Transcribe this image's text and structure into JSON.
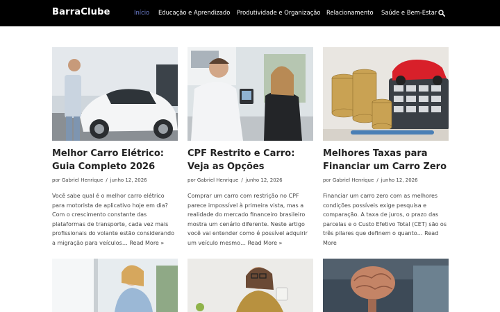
{
  "header": {
    "brand": "BarraClube",
    "nav": [
      {
        "label": "Início",
        "active": true
      },
      {
        "label": "Educação e Aprendizado",
        "active": false
      },
      {
        "label": "Produtividade e Organização",
        "active": false
      },
      {
        "label": "Relacionamento",
        "active": false
      },
      {
        "label": "Saúde e Bem-Estar",
        "active": false
      }
    ],
    "search_icon": "search-icon"
  },
  "colors": {
    "topbar": "#000000",
    "nav_active": "#6d7fd0",
    "title": "#222222",
    "text": "#444444"
  },
  "posts": [
    {
      "title": "Melhor Carro Elétrico: Guia Completo 2026",
      "author": "por Gabriel Henrique",
      "date": "junho 12, 2026",
      "excerpt": "Você sabe qual é o melhor carro elétrico para motorista de aplicativo hoje em dia? Com o crescimento constante das plataformas de transporte, cada vez mais profissionais do volante estão considerando a migração para veículos…",
      "read_more": "Read More »",
      "image": "man charging white electric car"
    },
    {
      "title": "CPF Restrito e Carro: Veja as Opções",
      "author": "por Gabriel Henrique",
      "date": "junho 12, 2026",
      "excerpt": "Comprar um carro com restrição no CPF parece impossível à primeira vista, mas a realidade do mercado financeiro brasileiro mostra um cenário diferente. Neste artigo você vai entender como é possível adquirir um veículo mesmo…",
      "read_more": "Read More »",
      "image": "car dealer with client at desk"
    },
    {
      "title": "Melhores Taxas para Financiar um Carro Zero",
      "author": "por Gabriel Henrique",
      "date": "junho 12, 2026",
      "excerpt": "Financiar um carro zero com as melhores condições possíveis exige pesquisa e comparação. A taxa de juros, o prazo das parcelas e o Custo Efetivo Total (CET) são os três pilares que definem o quanto…",
      "read_more": "Read More",
      "image": "coins calculator and red toy car"
    }
  ],
  "bottom_row": [
    {
      "image": "woman smiling at laptop"
    },
    {
      "image": "woman with coffee mug thumbs down"
    },
    {
      "image": "brain model in office"
    }
  ]
}
